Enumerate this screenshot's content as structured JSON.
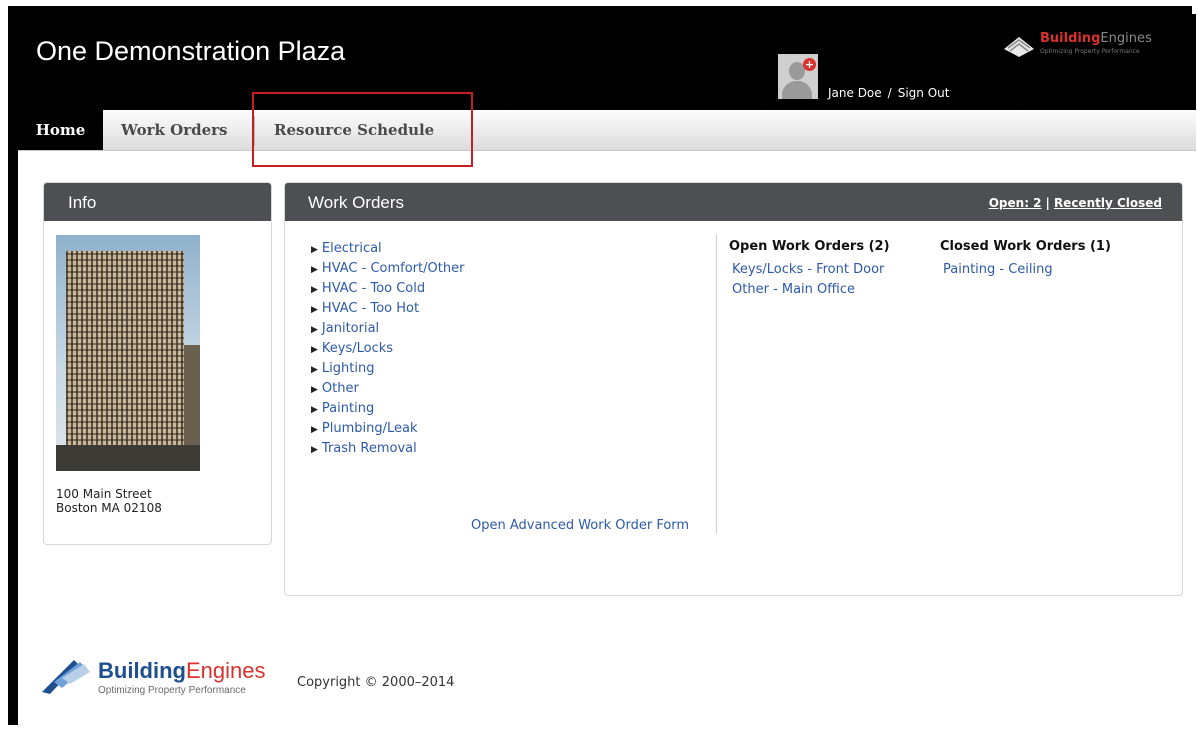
{
  "header": {
    "title": "One Demonstration Plaza",
    "user_name": "Jane Doe",
    "separator": "/",
    "sign_out": "Sign Out",
    "brand": {
      "name_a": "Building",
      "name_b": "Engines",
      "tagline": "Optimizing Property Performance"
    }
  },
  "tabs": [
    {
      "label": "Home",
      "active": true
    },
    {
      "label": "Work Orders",
      "active": false
    },
    {
      "label": "Resource Schedule",
      "active": false
    }
  ],
  "info": {
    "title": "Info",
    "address_line1": "100 Main Street",
    "address_line2": "Boston MA 02108"
  },
  "work_orders": {
    "title": "Work Orders",
    "open_link": "Open: 2",
    "divider": "|",
    "recent_link": "Recently Closed",
    "categories": [
      "Electrical",
      "HVAC - Comfort/Other",
      "HVAC - Too Cold",
      "HVAC - Too Hot",
      "Janitorial",
      "Keys/Locks",
      "Lighting",
      "Other",
      "Painting",
      "Plumbing/Leak",
      "Trash Removal"
    ],
    "advanced_link": "Open Advanced Work Order Form",
    "open_heading": "Open Work Orders (2)",
    "open_items": [
      "Keys/Locks - Front Door",
      "Other - Main Office"
    ],
    "closed_heading": "Closed Work Orders (1)",
    "closed_items": [
      "Painting - Ceiling"
    ]
  },
  "footer": {
    "brand_a": "Building",
    "brand_b": "Engines",
    "tagline": "Optimizing Property Performance",
    "copyright": "Copyright © 2000–2014"
  },
  "colors": {
    "header_bg": "#000000",
    "panel_head": "#4d4f53",
    "link": "#2d5aa8",
    "brand_red": "#d9312d",
    "highlight": "#c81e1e"
  }
}
